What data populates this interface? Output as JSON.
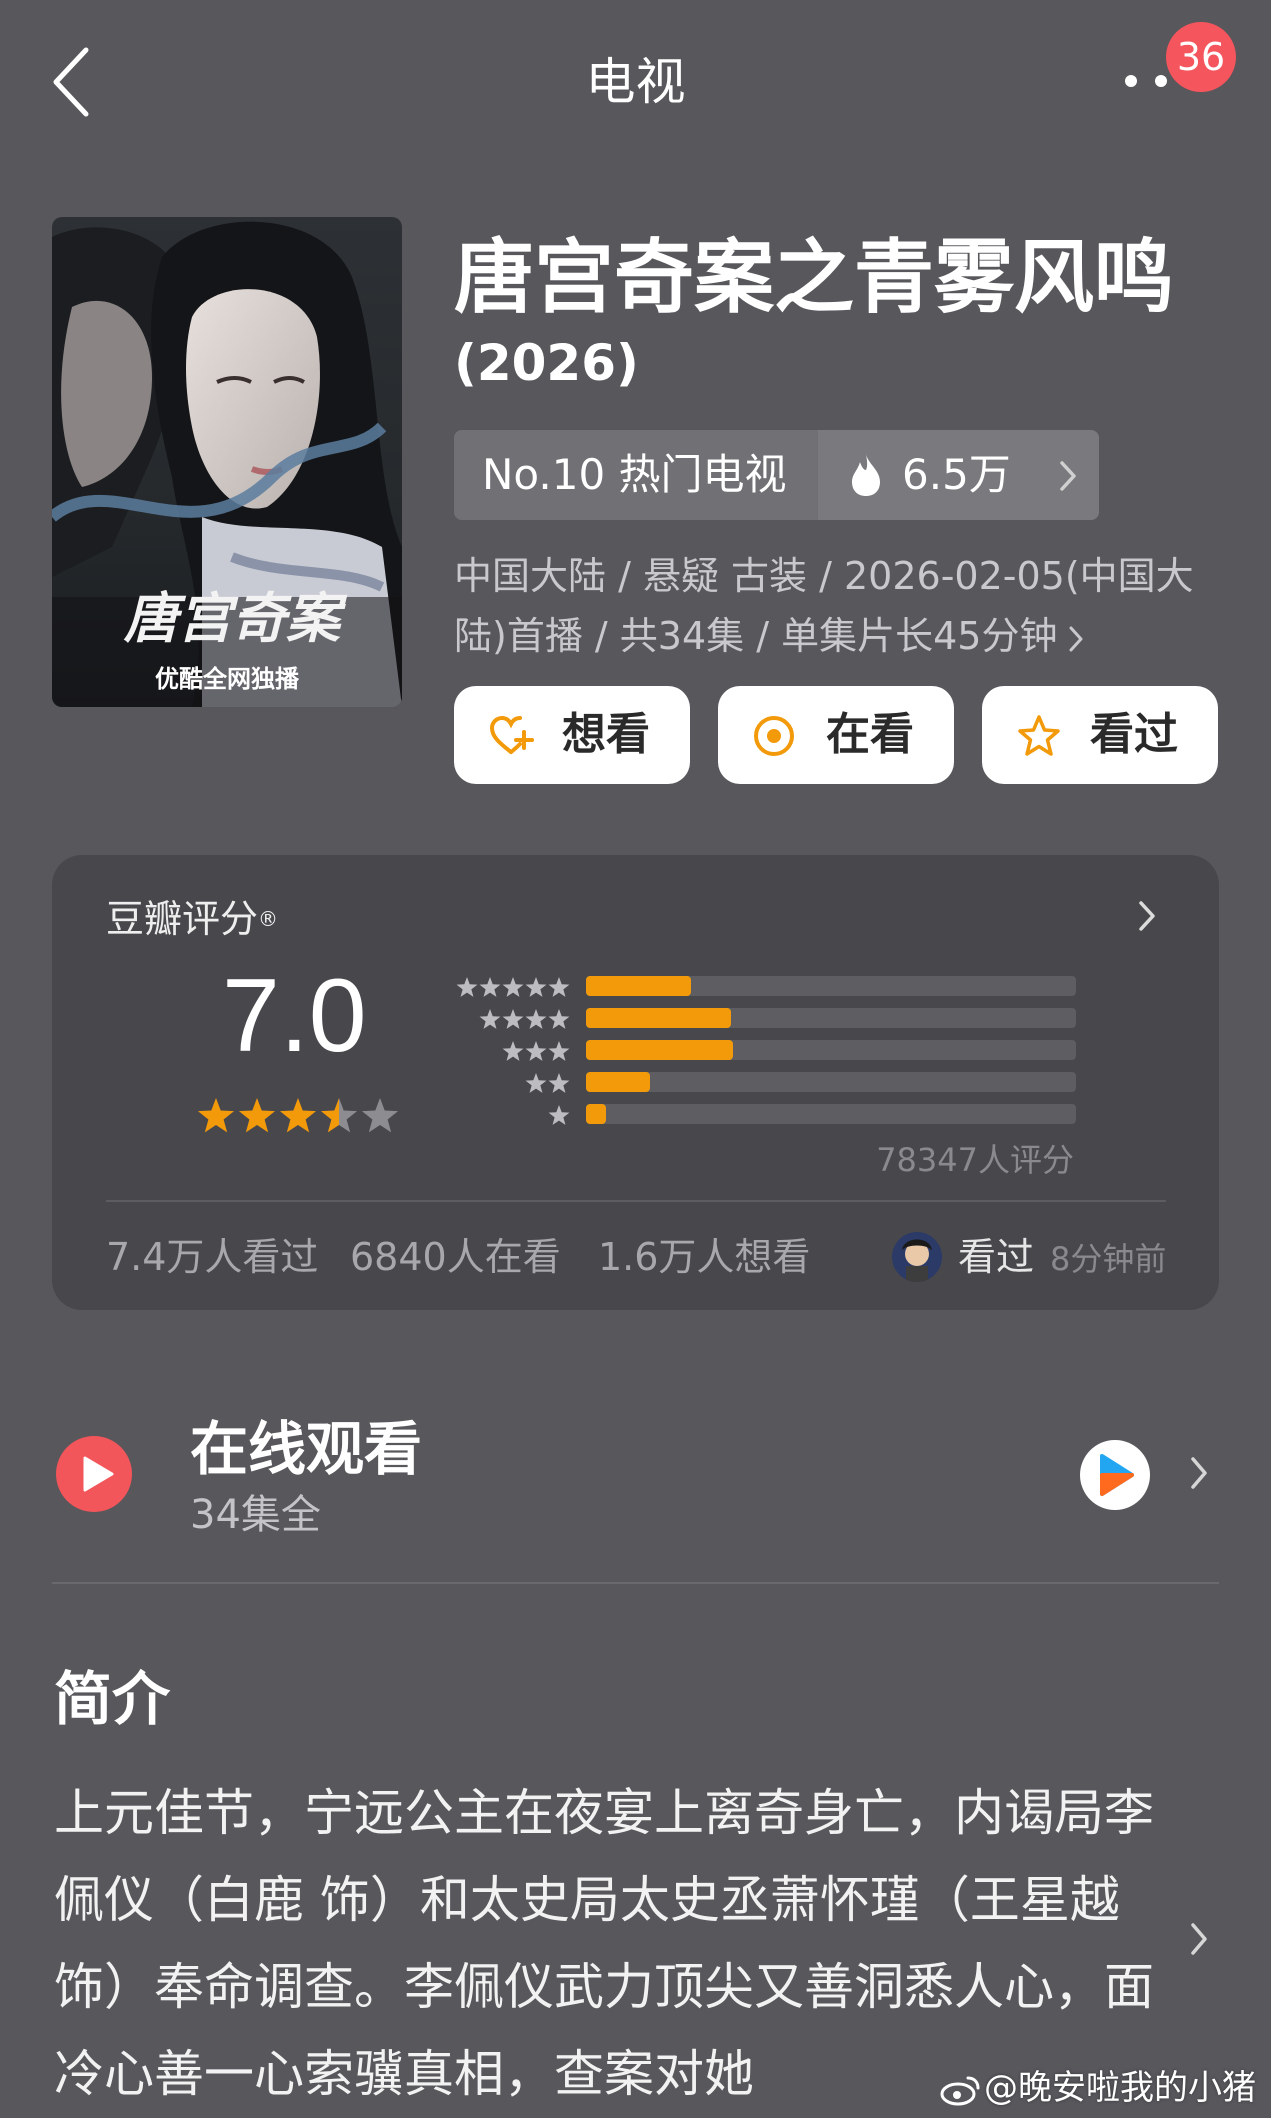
{
  "header": {
    "title": "电视",
    "notification_count": "36"
  },
  "movie": {
    "title": "唐宫奇案之青雾风鸣",
    "year": "(2026)",
    "poster": {
      "calligraphy": "唐宫奇案",
      "tagline": "优酷全网独播"
    },
    "rank_label": "No.10 热门电视",
    "heat": "6.5万",
    "meta_line1": "中国大陆 / 悬疑 古装 / 2026-02-05(中国大",
    "meta_line2": "陆)首播 / 共34集 / 单集片长45分钟"
  },
  "actions": {
    "want": "想看",
    "watching": "在看",
    "watched": "看过"
  },
  "rating": {
    "title": "豆瓣评分",
    "registered": "®",
    "score": "7.0",
    "stars": 3.5,
    "distribution": [
      {
        "stars": 5,
        "fraction": 0.215
      },
      {
        "stars": 4,
        "fraction": 0.295
      },
      {
        "stars": 3,
        "fraction": 0.3
      },
      {
        "stars": 2,
        "fraction": 0.13
      },
      {
        "stars": 1,
        "fraction": 0.04
      }
    ],
    "count": "78347人评分",
    "watched_count": "7.4万人看过",
    "watching_count": "6840人在看",
    "want_count": "1.6万人想看",
    "friend_action": "看过",
    "friend_time": "8分钟前"
  },
  "watch": {
    "title": "在线观看",
    "subtitle": "34集全"
  },
  "intro": {
    "heading": "简介",
    "text": "上元佳节，宁远公主在夜宴上离奇身亡，内谒局李佩仪（白鹿 饰）和太史局太史丞萧怀瑾（王星越 饰）奉命调查。李佩仪武力顶尖又善洞悉人心，面冷心善一心索骥真相，查案对她"
  },
  "watermark": "@晚安啦我的小猪",
  "colors": {
    "background": "#58575c",
    "card": "#48474c",
    "accent": "#f29a0a",
    "badge": "#f5555d"
  }
}
